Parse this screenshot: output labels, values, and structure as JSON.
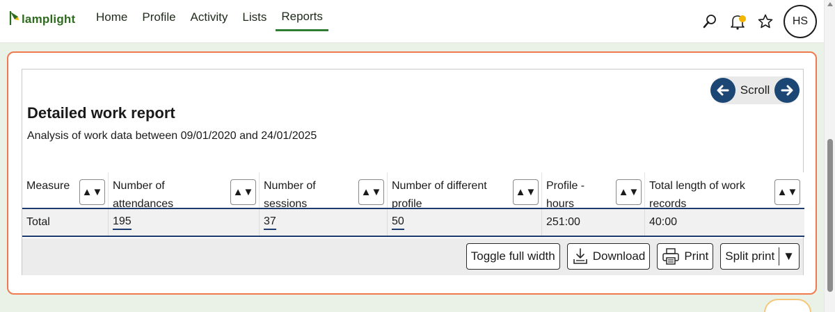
{
  "app": {
    "logo_text": "lamplight"
  },
  "nav": {
    "items": [
      "Home",
      "Profile",
      "Activity",
      "Lists",
      "Reports"
    ],
    "active": "Reports"
  },
  "top_icons": [
    "search-icon",
    "bell-icon",
    "star-icon"
  ],
  "user": {
    "initials": "HS"
  },
  "report": {
    "scroll_label": "Scroll",
    "title": "Detailed work report",
    "subtitle": "Analysis of work data between 09/01/2020 and 24/01/2025",
    "columns": [
      {
        "label": "Measure"
      },
      {
        "label": "Number of attendances"
      },
      {
        "label": "Number of sessions"
      },
      {
        "label": "Number of different profile"
      },
      {
        "label": "Profile - hours"
      },
      {
        "label": "Total length of work records"
      }
    ],
    "rows": [
      {
        "cells": [
          "Total",
          "195",
          "37",
          "50",
          "251:00",
          "40:00"
        ]
      }
    ],
    "actions": {
      "toggle": "Toggle full width",
      "download": "Download",
      "print": "Print",
      "split_print": "Split print"
    }
  },
  "colors": {
    "accent_green": "#2e7d32",
    "panel_border": "#f0794d",
    "navy": "#1c4775"
  }
}
